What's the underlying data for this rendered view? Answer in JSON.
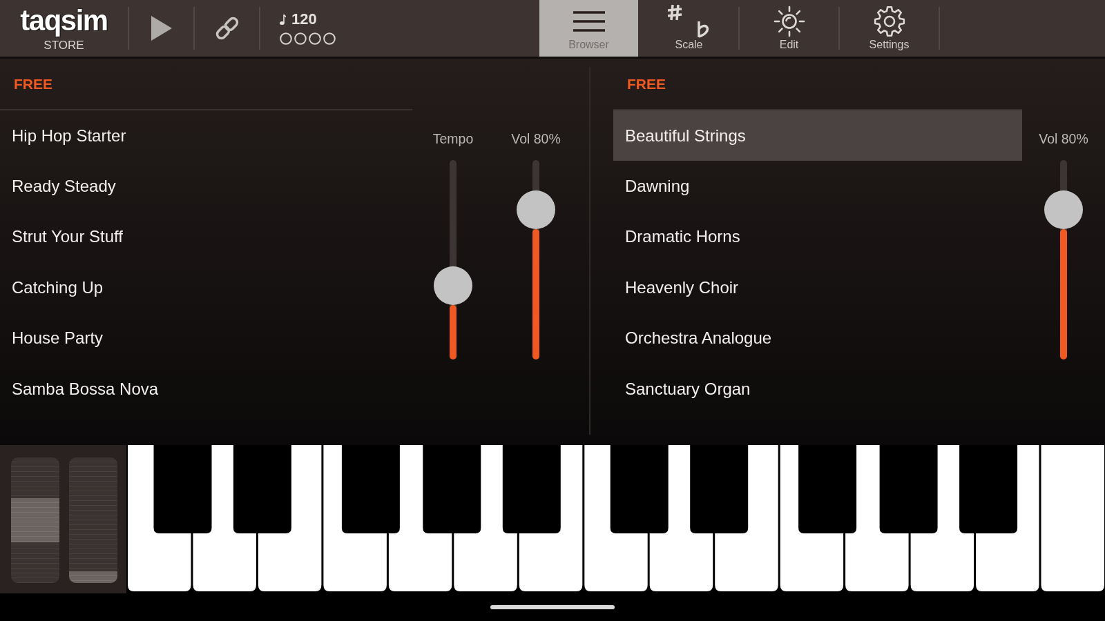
{
  "toolbar": {
    "logo": "taqsim",
    "store_label": "STORE",
    "tempo": "120",
    "beats": [
      {
        "on": false
      },
      {
        "on": false
      },
      {
        "on": false
      },
      {
        "on": false
      }
    ]
  },
  "tabs": [
    {
      "label": "Browser",
      "selected": true
    },
    {
      "label": "Scale",
      "selected": false
    },
    {
      "label": "Edit",
      "selected": false
    },
    {
      "label": "Settings",
      "selected": false
    }
  ],
  "panels": [
    {
      "header": "FREE",
      "items": [
        {
          "label": "Hip Hop Starter",
          "selected": false
        },
        {
          "label": "Ready Steady",
          "selected": false
        },
        {
          "label": "Strut Your Stuff",
          "selected": false
        },
        {
          "label": "Catching Up",
          "selected": false
        },
        {
          "label": "House Party",
          "selected": false
        },
        {
          "label": "Samba Bossa Nova",
          "selected": false
        }
      ],
      "sliders": [
        {
          "label": "Tempo",
          "level": 0.37
        },
        {
          "label": "Vol 80%",
          "level": 0.75
        }
      ]
    },
    {
      "header": "FREE",
      "items": [
        {
          "label": "Beautiful Strings",
          "selected": true
        },
        {
          "label": "Dawning",
          "selected": false
        },
        {
          "label": "Dramatic Horns",
          "selected": false
        },
        {
          "label": "Heavenly Choir",
          "selected": false
        },
        {
          "label": "Orchestra Analogue",
          "selected": false
        },
        {
          "label": "Sanctuary Organ",
          "selected": false
        }
      ],
      "sliders": [
        {
          "label": "Vol 80%",
          "level": 0.75
        }
      ]
    }
  ],
  "keyboard": {
    "wheels": [
      {
        "kind": "pitch",
        "level": 0.5
      },
      {
        "kind": "mod",
        "level": 0
      }
    ]
  }
}
